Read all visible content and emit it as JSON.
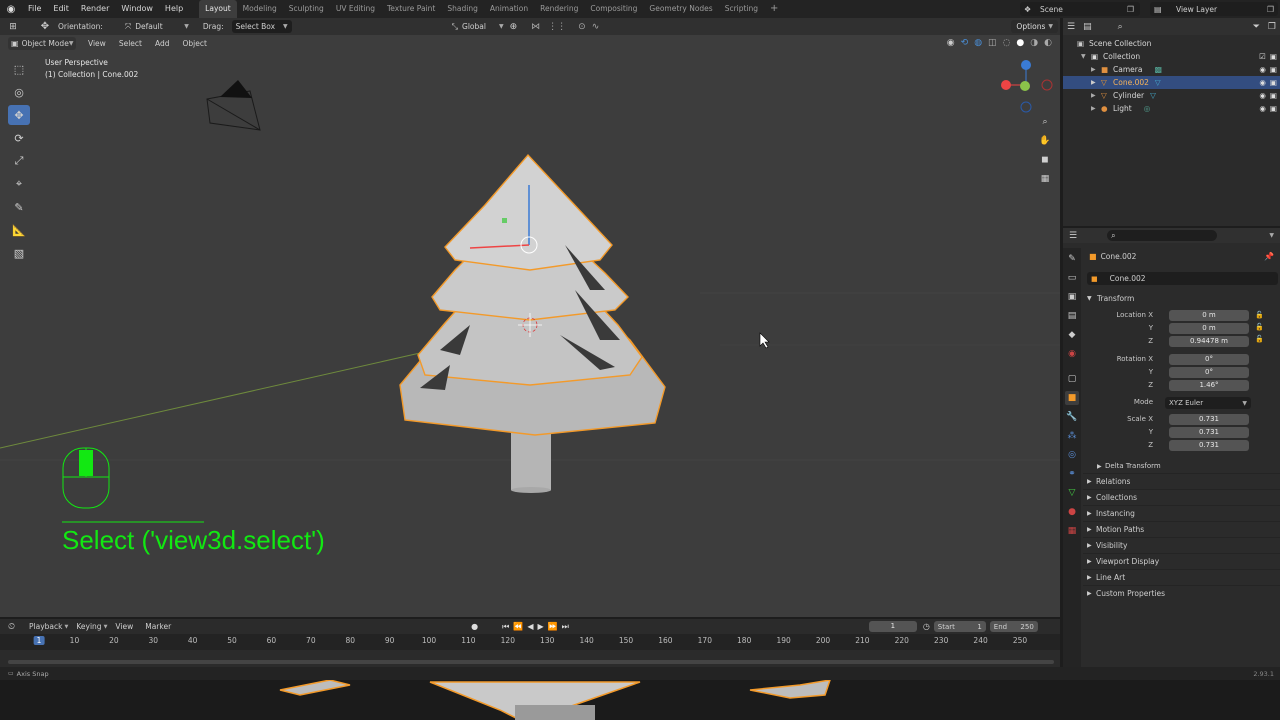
{
  "topbar": {
    "menus": [
      "File",
      "Edit",
      "Render",
      "Window",
      "Help"
    ],
    "workspaces": [
      "Layout",
      "Modeling",
      "Sculpting",
      "UV Editing",
      "Texture Paint",
      "Shading",
      "Animation",
      "Rendering",
      "Compositing",
      "Geometry Nodes",
      "Scripting"
    ],
    "add_tab": "+",
    "scene": "Scene",
    "view_layer": "View Layer"
  },
  "tool_header": {
    "orientation_label": "Orientation:",
    "orientation_value": "Default",
    "drag_label": "Drag:",
    "drag_value": "Select Box",
    "transform_orientation": "Global",
    "options": "Options"
  },
  "viewport_header": {
    "mode": "Object Mode",
    "menus": [
      "View",
      "Select",
      "Add",
      "Object"
    ]
  },
  "viewport": {
    "perspective": "User Perspective",
    "collection_info": "(1) Collection | Cone.002",
    "operator_text": "Select ('view3d.select')"
  },
  "outliner": {
    "root": "Scene Collection",
    "collection": "Collection",
    "items": [
      {
        "name": "Camera"
      },
      {
        "name": "Cone.002"
      },
      {
        "name": "Cylinder"
      },
      {
        "name": "Light"
      }
    ]
  },
  "properties": {
    "object_name": "Cone.002",
    "data_name": "Cone.002",
    "transform_label": "Transform",
    "location": {
      "label": "Location X",
      "x": "0 m",
      "y": "0 m",
      "z": "0.94478 m"
    },
    "rotation": {
      "label": "Rotation X",
      "x": "0°",
      "y": "0°",
      "z": "1.46°"
    },
    "mode": {
      "label": "Mode",
      "value": "XYZ Euler"
    },
    "scale": {
      "label": "Scale X",
      "x": "0.731",
      "y": "0.731",
      "z": "0.731"
    },
    "axis": {
      "y": "Y",
      "z": "Z"
    },
    "delta": "Delta Transform",
    "sections": [
      "Relations",
      "Collections",
      "Instancing",
      "Motion Paths",
      "Visibility",
      "Viewport Display",
      "Line Art",
      "Custom Properties"
    ]
  },
  "timeline": {
    "menus": [
      "Playback",
      "Keying",
      "View",
      "Marker"
    ],
    "current_frame": "1",
    "start_label": "Start",
    "start": "1",
    "end_label": "End",
    "end": "250",
    "ticks": [
      "1",
      "10",
      "20",
      "30",
      "40",
      "50",
      "60",
      "70",
      "80",
      "90",
      "100",
      "110",
      "120",
      "130",
      "140",
      "150",
      "160",
      "170",
      "180",
      "190",
      "200",
      "210",
      "220",
      "230",
      "240",
      "250"
    ]
  },
  "status": {
    "left": "Axis Snap",
    "version": "2.93.1"
  },
  "colors": {
    "accent": "#4772b3",
    "selection": "#f39a2a",
    "green": "#12e812"
  }
}
